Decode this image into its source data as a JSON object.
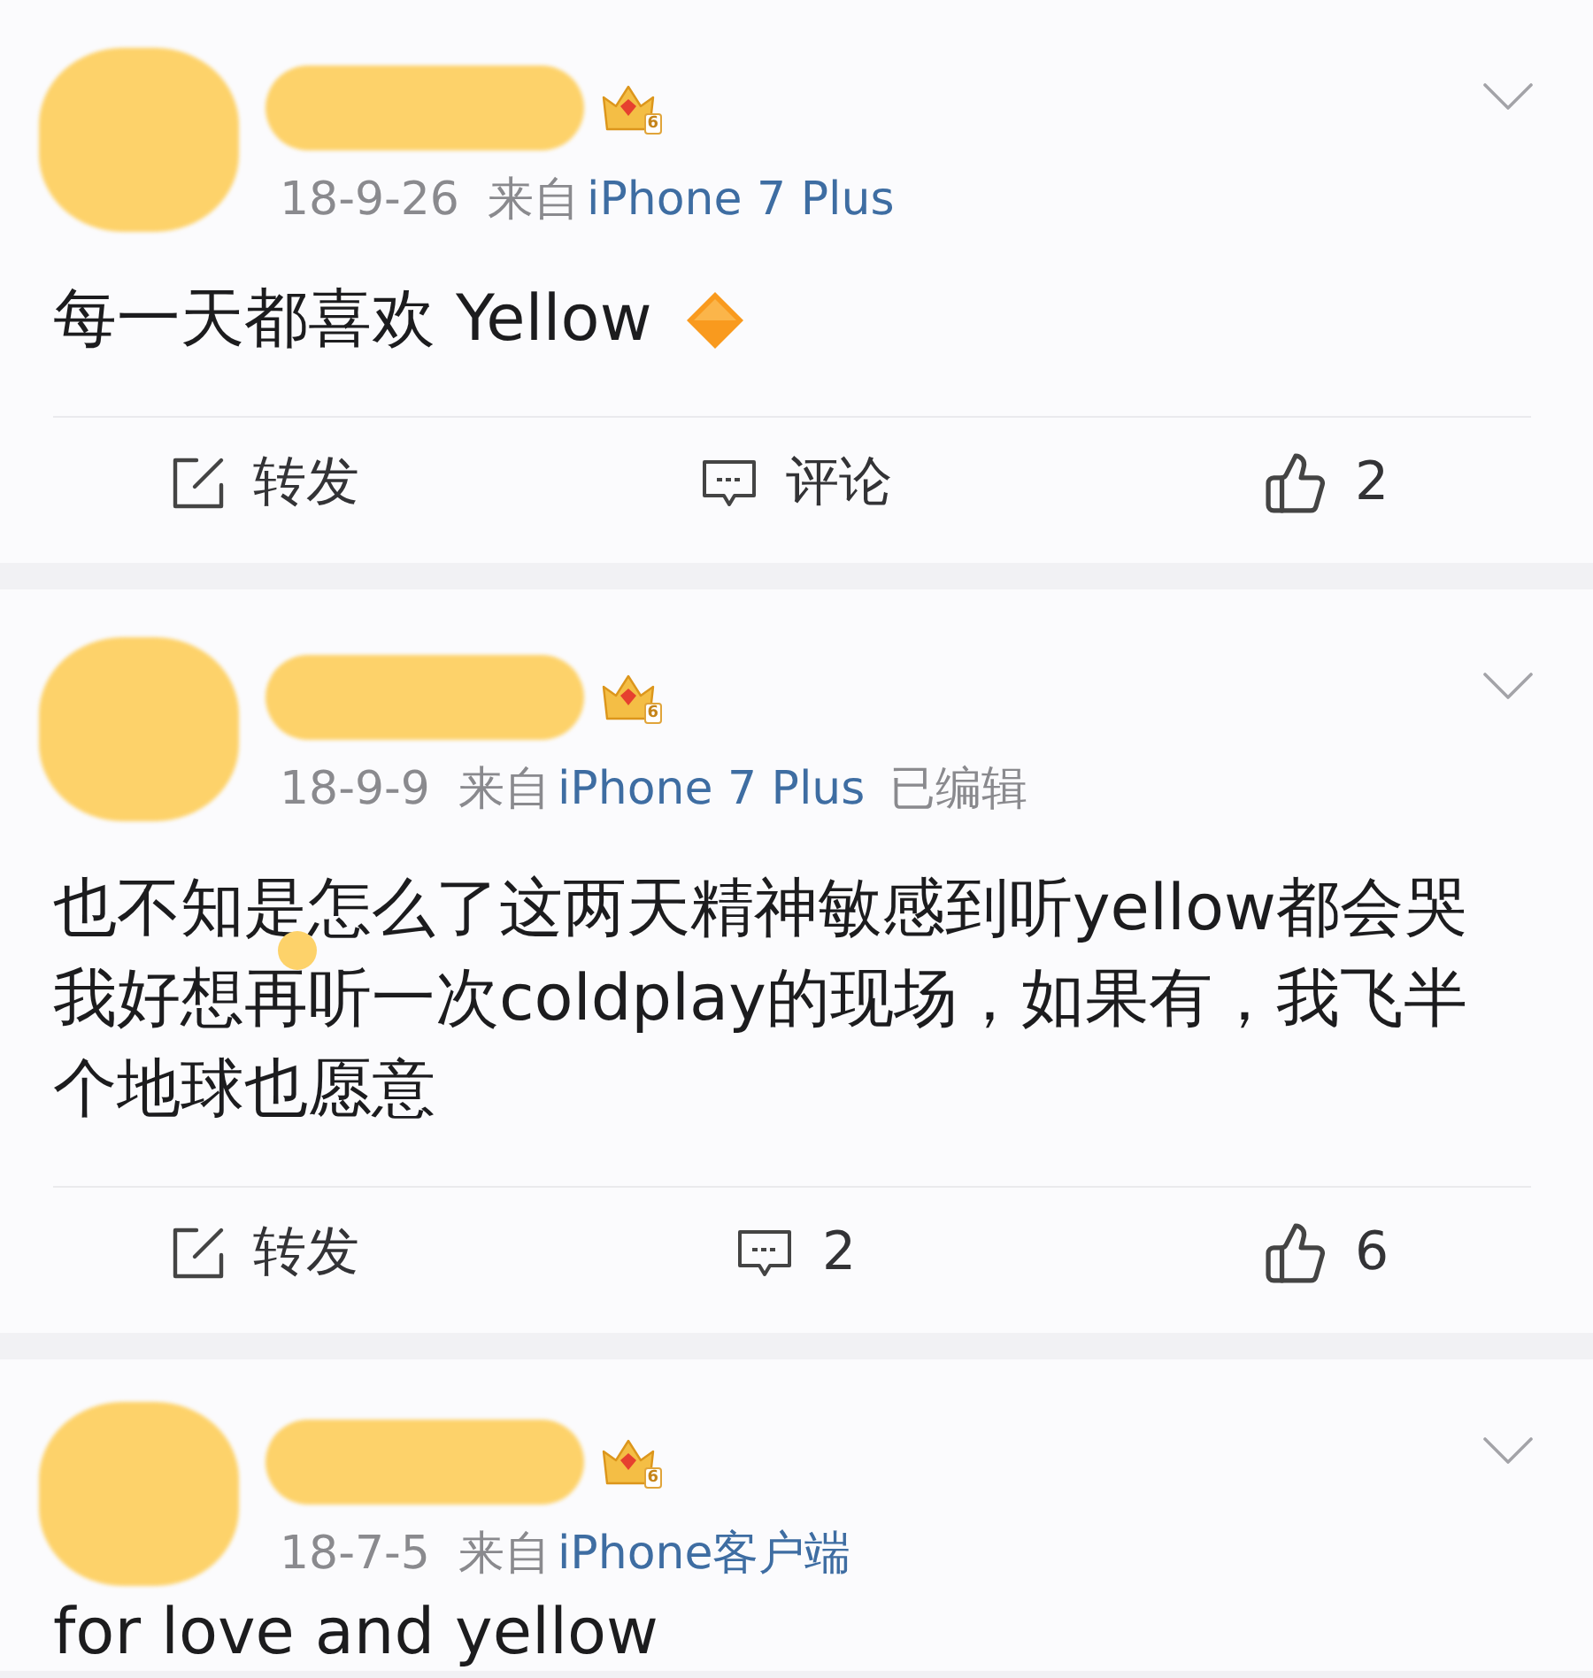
{
  "posts": [
    {
      "author_badge": "6",
      "time": "18-9-26",
      "source_prefix": "来自",
      "source": "iPhone 7 Plus",
      "content": "每一天都喜欢 Yellow",
      "diamond_emoji": true,
      "actions": [
        {
          "kind": "repost",
          "label": "转发"
        },
        {
          "kind": "comment",
          "label": "评论"
        },
        {
          "kind": "like",
          "label": "2"
        }
      ]
    },
    {
      "author_badge": "6",
      "time": "18-9-9",
      "source_prefix": "来自",
      "source": "iPhone 7 Plus",
      "edited_label": "已编辑",
      "content": "也不知是怎么了这两天精神敏感到听yellow都会哭我好想再听一次coldplay的现场，如果有，我飞半个地球也愿意",
      "redaction_dot": true,
      "actions": [
        {
          "kind": "repost",
          "label": "转发"
        },
        {
          "kind": "comment",
          "label": "2"
        },
        {
          "kind": "like",
          "label": "6"
        }
      ]
    },
    {
      "author_badge": "6",
      "time": "18-7-5",
      "source_prefix": "来自",
      "source": "iPhone客户端",
      "content": "for love and yellow"
    }
  ]
}
